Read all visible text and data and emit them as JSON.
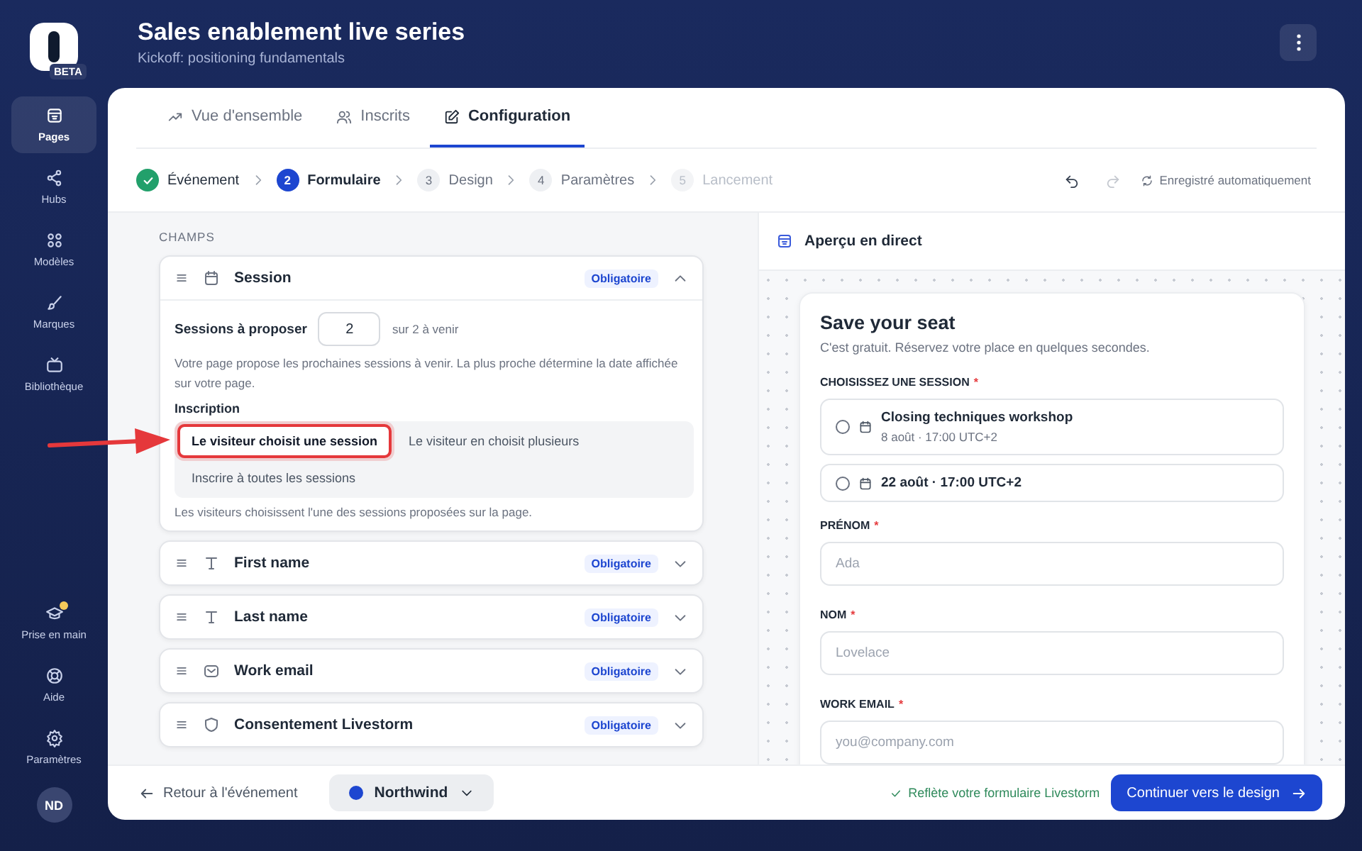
{
  "app": {
    "badge": "BETA"
  },
  "sidebar": {
    "items": [
      {
        "label": "Pages",
        "selected": true
      },
      {
        "label": "Hubs",
        "selected": false
      },
      {
        "label": "Modèles",
        "selected": false
      },
      {
        "label": "Marques",
        "selected": false
      },
      {
        "label": "Bibliothèque",
        "selected": false
      }
    ],
    "bottom_items": [
      {
        "label": "Prise en main",
        "notification": true
      },
      {
        "label": "Aide",
        "notification": false
      },
      {
        "label": "Paramètres",
        "notification": false
      }
    ],
    "avatar": "ND"
  },
  "header": {
    "title": "Sales enablement live series",
    "subtitle": "Kickoff: positioning fundamentals"
  },
  "tabs": [
    {
      "label": "Vue d'ensemble",
      "selected": false
    },
    {
      "label": "Inscrits",
      "selected": false
    },
    {
      "label": "Configuration",
      "selected": true
    }
  ],
  "stepper": {
    "steps": [
      {
        "label": "Événement",
        "completed": true,
        "selected": false,
        "disabled": false
      },
      {
        "number": "2",
        "label": "Formulaire",
        "completed": false,
        "selected": true,
        "disabled": false
      },
      {
        "number": "3",
        "label": "Design",
        "completed": false,
        "selected": false,
        "disabled": false
      },
      {
        "number": "4",
        "label": "Paramètres",
        "completed": false,
        "selected": false,
        "disabled": false
      },
      {
        "number": "5",
        "label": "Lancement",
        "completed": false,
        "selected": false,
        "disabled": true
      }
    ],
    "redo_disabled": true,
    "autosave": "Enregistré automatiquement"
  },
  "fields_panel": {
    "heading": "CHAMPS",
    "fields": [
      {
        "kind": "session",
        "label": "Session",
        "badge": "Obligatoire",
        "expanded": true,
        "settings": {
          "count_label": "Sessions à proposer",
          "count_value": "2",
          "count_suffix": "sur 2 à venir",
          "help": "Votre page propose les prochaines sessions à venir. La plus proche détermine la date affichée sur votre page.",
          "mode_label": "Inscription",
          "modes": [
            {
              "label": "Le visiteur choisit une session",
              "selected": true,
              "highlighted": true
            },
            {
              "label": "Le visiteur en choisit plusieurs",
              "selected": false,
              "highlighted": false
            },
            {
              "label": "Inscrire à toutes les sessions",
              "selected": false,
              "highlighted": false
            }
          ],
          "mode_help": "Les visiteurs choisissent l'une des sessions proposées sur la page."
        }
      },
      {
        "kind": "text",
        "label": "First name",
        "badge": "Obligatoire",
        "expanded": false
      },
      {
        "kind": "text",
        "label": "Last name",
        "badge": "Obligatoire",
        "expanded": false
      },
      {
        "kind": "email",
        "label": "Work email",
        "badge": "Obligatoire",
        "expanded": false
      },
      {
        "kind": "consent",
        "label": "Consentement Livestorm",
        "badge": "Obligatoire",
        "expanded": false
      }
    ]
  },
  "callout": {
    "kind": "arrow"
  },
  "preview": {
    "title": "Aperçu en direct",
    "form": {
      "heading": "Save your seat",
      "intro": "C'est gratuit. Réservez votre place en quelques secondes.",
      "session_label": "CHOISISSEZ UNE SESSION",
      "session_marker": "*",
      "sessions": [
        {
          "title": "Closing techniques workshop",
          "when": "8 août · 17:00 UTC+2",
          "selected": false
        },
        {
          "when": "22 août · 17:00 UTC+2",
          "selected": false
        }
      ],
      "fields": [
        {
          "label": "PRÉNOM",
          "marker": "*",
          "placeholder": "Ada"
        },
        {
          "label": "NOM",
          "marker": "*",
          "placeholder": "Lovelace"
        },
        {
          "label": "WORK EMAIL",
          "marker": "*",
          "placeholder": "you@company.com"
        }
      ]
    }
  },
  "footer": {
    "back": "Retour à l'événement",
    "workspace": {
      "name": "Northwind",
      "color": "#1d46d0"
    },
    "sync_note": "Reflète votre formulaire Livestorm",
    "primary": "Continuer vers le design"
  }
}
